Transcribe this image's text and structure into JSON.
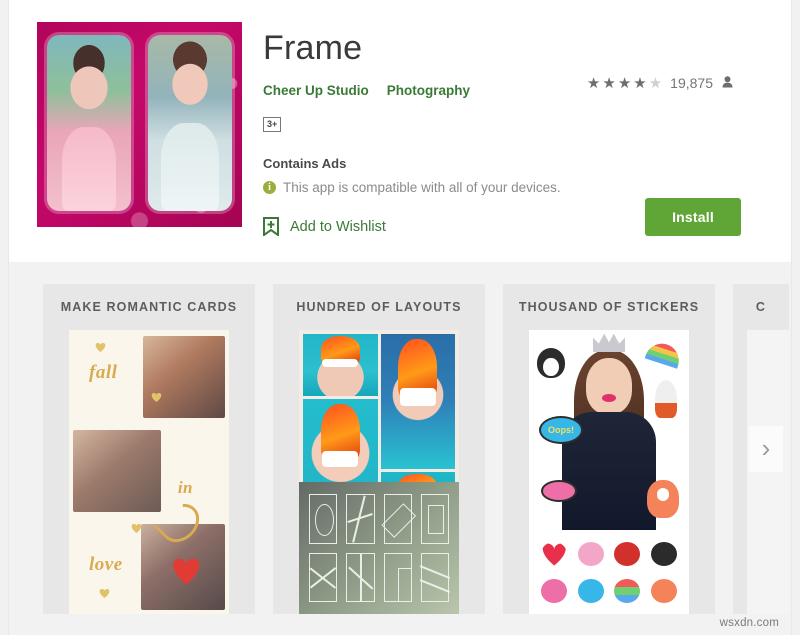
{
  "app": {
    "title": "Frame",
    "developer": "Cheer Up Studio",
    "category": "Photography",
    "content_rating_badge": "3+",
    "contains_ads": "Contains Ads",
    "compatibility": "This app is compatible with all of your devices.",
    "wishlist_label": "Add to Wishlist",
    "install_label": "Install",
    "icon_name": "app-icon-two-photo-pink-frame"
  },
  "rating": {
    "stars_filled": 4,
    "stars_total": 5,
    "filled_glyph": "★",
    "empty_glyph": "★",
    "count": "19,875",
    "person_glyph": "👤"
  },
  "icons": {
    "info": "i",
    "chevron_right": "›"
  },
  "screenshots": [
    {
      "caption": "MAKE ROMANTIC CARDS",
      "script_1": "fall",
      "script_2": "in",
      "script_3": "love"
    },
    {
      "caption": "HUNDRED OF LAYOUTS"
    },
    {
      "caption": "THOUSAND OF STICKERS",
      "sticker_text": "Oops!"
    },
    {
      "caption": "C"
    }
  ],
  "watermark": "wsxdn.com",
  "colors": {
    "install_green": "#60a637",
    "link_green": "#3a7a36",
    "icon_pink": "#b2055c",
    "shots_bg": "#f2f2f2"
  }
}
